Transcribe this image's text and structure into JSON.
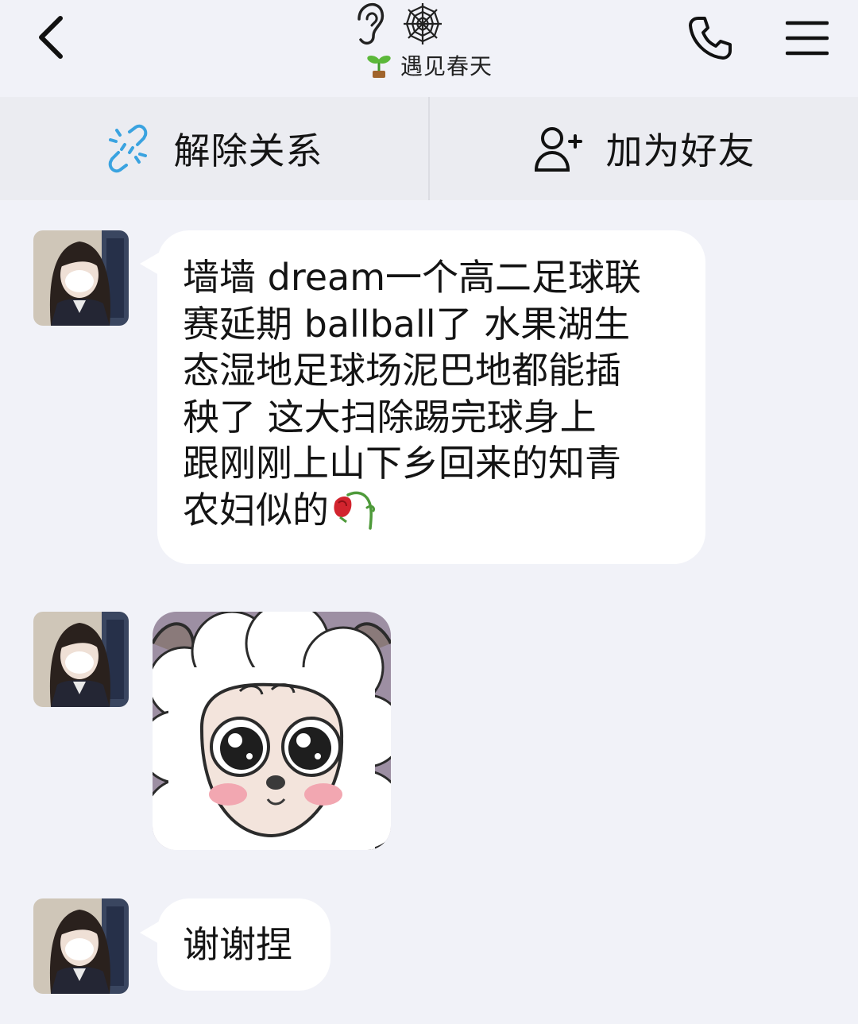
{
  "header": {
    "title": "遇见春天",
    "back_icon": "chevron-left-icon",
    "status_icons": [
      "ear-icon",
      "spiderweb-icon"
    ],
    "title_emoji": "sprout-icon",
    "phone_icon": "phone-icon",
    "menu_icon": "hamburger-menu-icon"
  },
  "actions": {
    "unlink_label": "解除关系",
    "unlink_icon": "broken-link-icon",
    "add_friend_label": "加为好友",
    "add_friend_icon": "add-user-icon"
  },
  "messages": [
    {
      "type": "text",
      "lines": [
        "墙墙 dream一个高二足球联",
        "赛延期 ballball了 水果湖生",
        "态湿地足球场泥巴地都能插",
        "秧了 这大扫除踢完球身上",
        "跟刚刚上山下乡回来的知青",
        "农妇似的"
      ],
      "trailing_emoji": "wilted-rose-icon"
    },
    {
      "type": "sticker",
      "sticker": "cartoon-sheep-sticker"
    },
    {
      "type": "text",
      "lines": [
        "谢谢捏"
      ]
    }
  ],
  "colors": {
    "background": "#f1f2f8",
    "action_bar": "#ebecf1",
    "bubble": "#ffffff",
    "link_icon": "#3aa3e0"
  }
}
